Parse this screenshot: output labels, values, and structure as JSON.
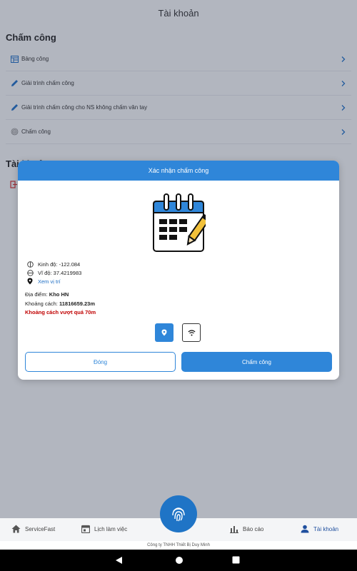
{
  "header": {
    "title": "Tài khoản"
  },
  "attendance_section": {
    "title": "Chấm công",
    "items": [
      {
        "label": "Bảng công",
        "icon": "calendar-table-icon"
      },
      {
        "label": "Giải trình chấm công",
        "icon": "pencil-icon"
      },
      {
        "label": "Giải trình chấm công cho NS không chấm vân tay",
        "icon": "pencil-icon"
      },
      {
        "label": "Chấm công",
        "icon": "fingerprint-icon"
      }
    ]
  },
  "account_section": {
    "title": "Tài khoản"
  },
  "dialog": {
    "title": "Xác nhận chấm công",
    "longitude": "Kinh độ: -122.084",
    "latitude": "Vĩ độ: 37.4219983",
    "view_location": "Xem vị trí",
    "place_label": "Địa điểm:",
    "place_value": "Kho HN",
    "distance_label": "Khoảng cách:",
    "distance_value": "11816659.23m",
    "warning": "Khoảng cách vượt quá 70m",
    "mode_gps_active": true,
    "close_label": "Đóng",
    "confirm_label": "Chấm công"
  },
  "bottom_nav": {
    "items": [
      {
        "label": "ServiceFast",
        "icon": "home-icon"
      },
      {
        "label": "Lịch làm việc",
        "icon": "calendar-icon"
      },
      {
        "label": "Báo cáo",
        "icon": "bar-chart-icon"
      },
      {
        "label": "Tài khoản",
        "icon": "person-icon",
        "active": true
      }
    ],
    "fab_icon": "fingerprint-icon"
  },
  "footer": {
    "company": "Công ty TNHH Thiết Bị Duy Minh"
  },
  "colors": {
    "primary": "#2f86d9",
    "warning": "#c00000",
    "fab": "#1f74c6"
  }
}
